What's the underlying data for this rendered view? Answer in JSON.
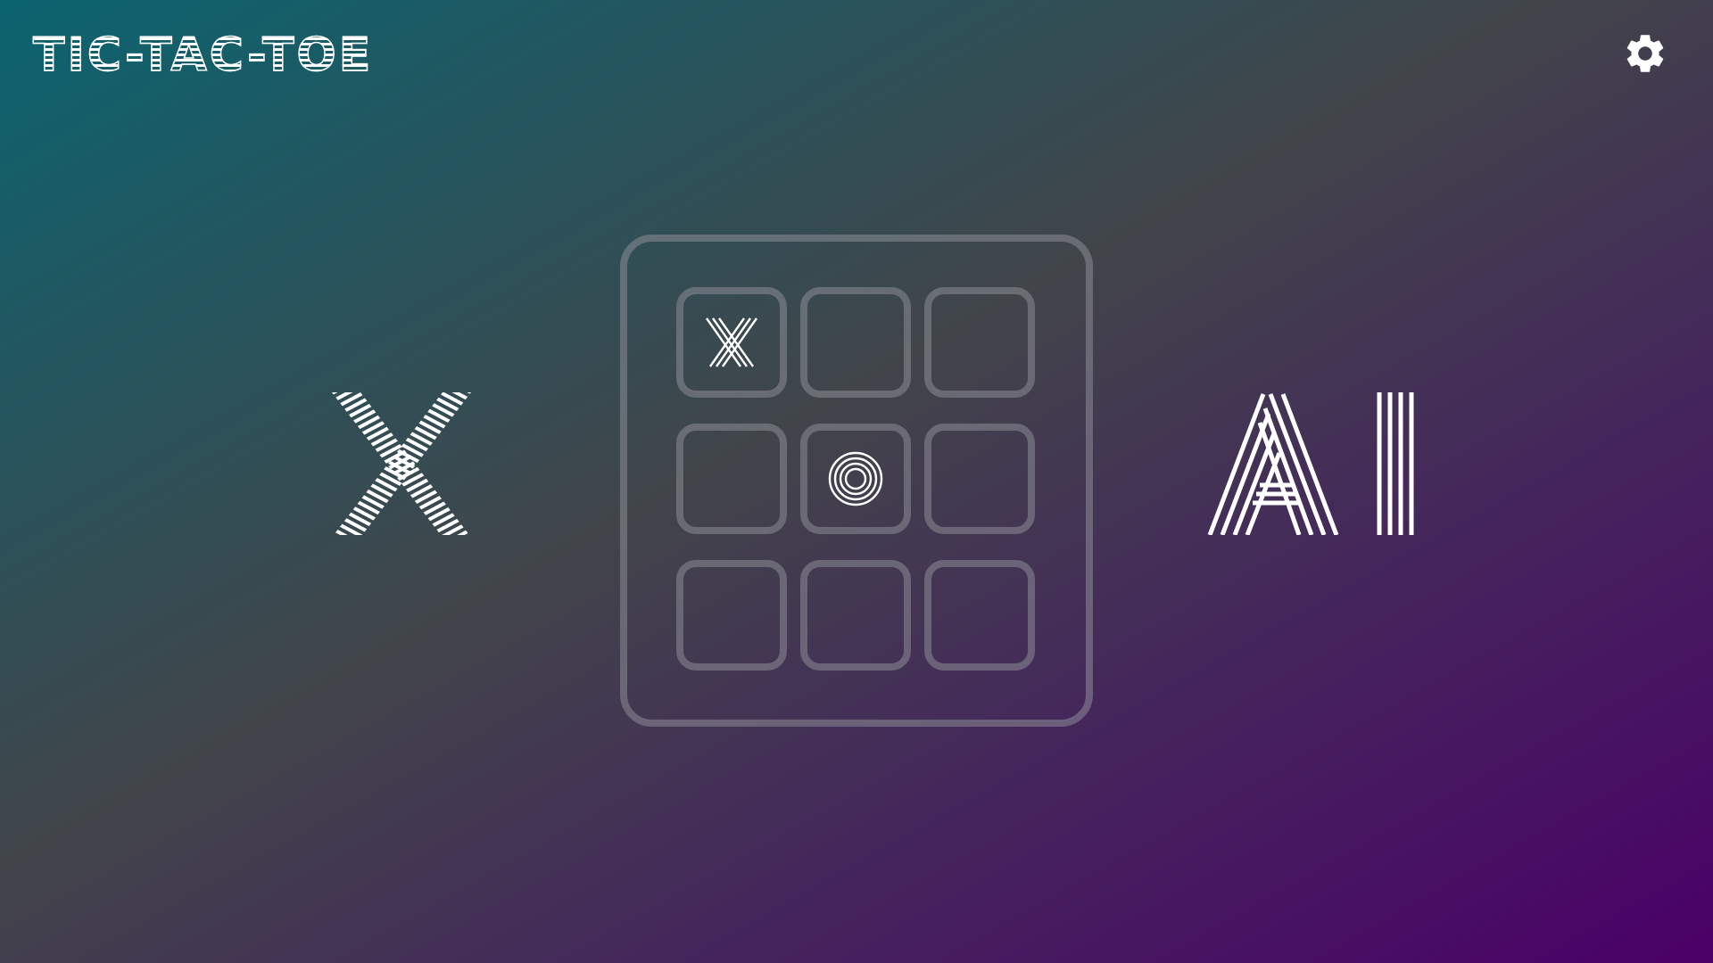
{
  "header": {
    "title": "TIC-TAC-TOE",
    "settings_icon": "gear-icon"
  },
  "players": {
    "left": {
      "label": "X"
    },
    "right": {
      "label": "AI"
    }
  },
  "board": {
    "cells": [
      "X",
      "",
      "",
      "",
      "O",
      "",
      "",
      "",
      ""
    ]
  },
  "colors": {
    "gradient_start": "#0b6470",
    "gradient_mid": "#41454a",
    "gradient_end": "#4a0068",
    "mark": "#ffffff",
    "outline": "#8c8c96"
  }
}
